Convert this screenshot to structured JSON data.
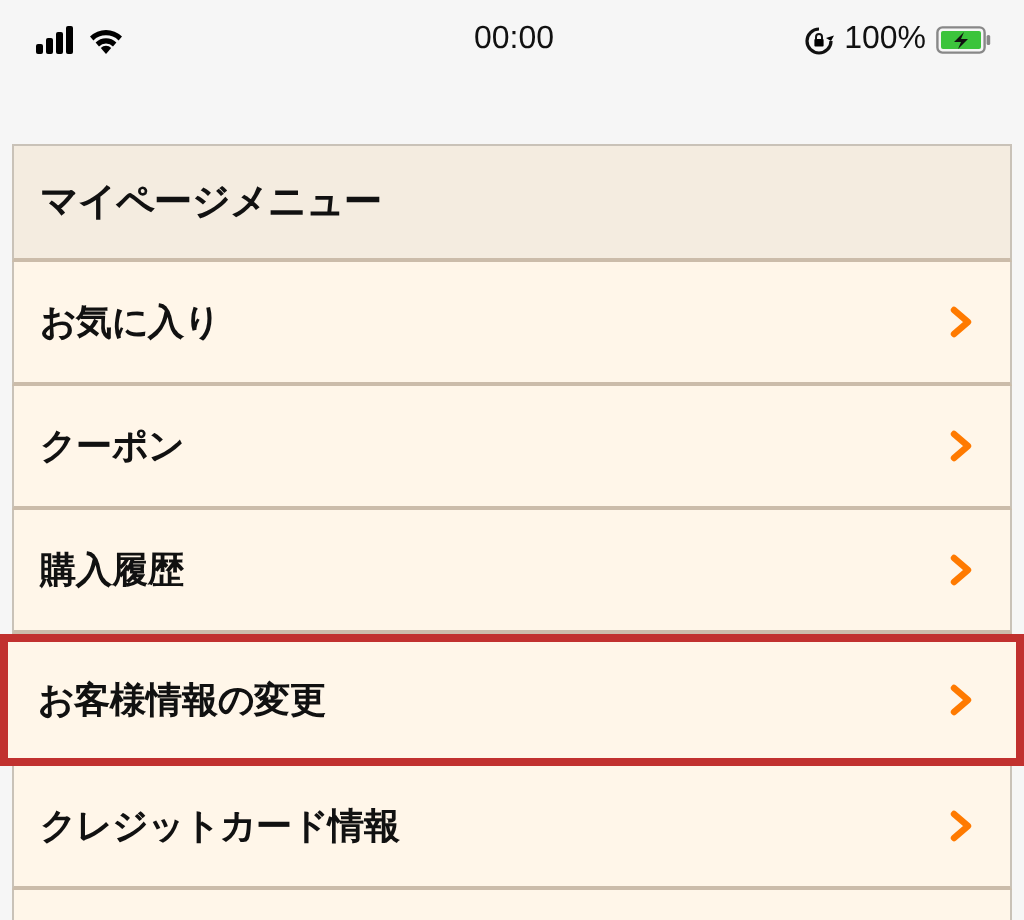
{
  "status_bar": {
    "time": "00:00",
    "battery_percent": "100%"
  },
  "menu": {
    "title": "マイページメニュー",
    "items": [
      {
        "label": "お気に入り",
        "selected": false
      },
      {
        "label": "クーポン",
        "selected": false
      },
      {
        "label": "購入履歴",
        "selected": false
      },
      {
        "label": "お客様情報の変更",
        "selected": true
      },
      {
        "label": "クレジットカード情報",
        "selected": false
      }
    ]
  }
}
